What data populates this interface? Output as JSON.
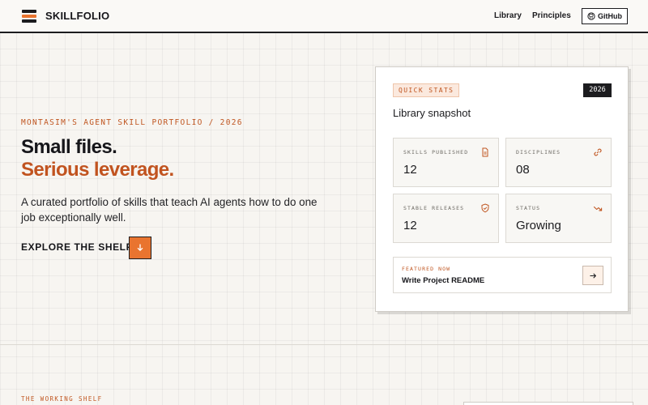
{
  "header": {
    "brand": "SKILLFOLIO",
    "nav": [
      {
        "label": "Library"
      },
      {
        "label": "Principles"
      }
    ],
    "github_label": "GitHub",
    "logo_colors": [
      "#1c1c1f",
      "#e9742f",
      "#1c1c1f"
    ]
  },
  "hero": {
    "eyebrow": "MONTASIM'S AGENT SKILL PORTFOLIO / 2026",
    "headline_1": "Small files.",
    "headline_2": "Serious leverage.",
    "description": "A curated portfolio of skills that teach AI agents how to do one job exceptionally well.",
    "cta_label": "EXPLORE THE SHELF",
    "cta_icon": "arrow-down-icon"
  },
  "stats_card": {
    "badge": "QUICK STATS",
    "year": "2026",
    "title": "Library snapshot",
    "stats": [
      {
        "label": "SKILLS PUBLISHED",
        "value": "12",
        "icon": "document-icon"
      },
      {
        "label": "DISCIPLINES",
        "value": "08",
        "icon": "link-icon"
      },
      {
        "label": "STABLE RELEASES",
        "value": "12",
        "icon": "shield-check-icon"
      },
      {
        "label": "STATUS",
        "value": "Growing",
        "icon": "trend-icon"
      }
    ],
    "featured": {
      "label": "FEATURED NOW",
      "title": "Write Project README",
      "icon": "arrow-right-icon"
    }
  },
  "shelf": {
    "eyebrow": "THE WORKING SHELF"
  },
  "colors": {
    "accent": "#e9742f",
    "accent_text": "#c05621",
    "ink": "#16161a",
    "background": "#f7f5f1"
  }
}
